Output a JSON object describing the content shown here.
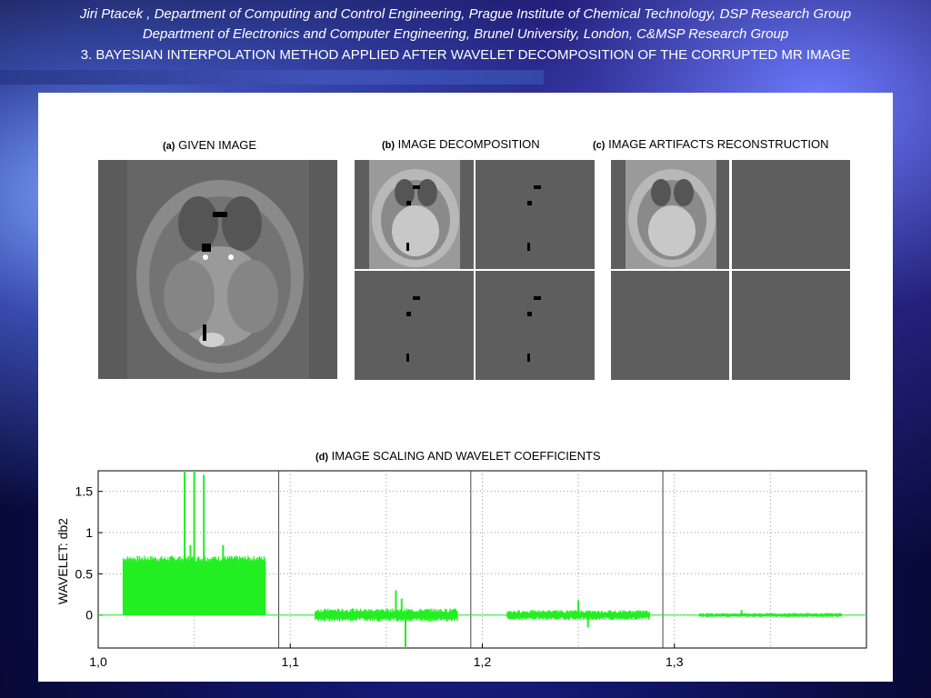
{
  "header": {
    "line1": "Jiri Ptacek ,  Department of Computing and Control Engineering, Prague Institute of Chemical Technology, DSP Research Group",
    "line2": "Department of Electronics and Computer Engineering, Brunel University, London, C&MSP Research Group",
    "line3": "3. BAYESIAN INTERPOLATION METHOD APPLIED AFTER WAVELET DECOMPOSITION OF THE CORRUPTED MR IMAGE"
  },
  "figures": {
    "a": {
      "tag": "(a)",
      "title": "GIVEN IMAGE"
    },
    "b": {
      "tag": "(b)",
      "title": "IMAGE DECOMPOSITION"
    },
    "c": {
      "tag": "(c)",
      "title": "IMAGE ARTIFACTS RECONSTRUCTION"
    },
    "d": {
      "tag": "(d)",
      "title": "IMAGE SCALING AND WAVELET COEFFICIENTS"
    }
  },
  "chart_data": {
    "type": "line",
    "title": "(d) IMAGE SCALING AND WAVELET COEFFICIENTS",
    "ylabel": "WAVELET: db2",
    "xlabel": "",
    "ylim": [
      -0.4,
      1.75
    ],
    "xlim": [
      0,
      4
    ],
    "ytick_labels": [
      "1.5",
      "1",
      "0.5",
      "0"
    ],
    "yticks": [
      1.5,
      1,
      0.5,
      0
    ],
    "xtick_labels": [
      "1,0",
      "1,1",
      "1,2",
      "1,3"
    ],
    "xticks": [
      0,
      1,
      2,
      3
    ],
    "dividers": [
      0.94,
      1.94,
      2.94
    ],
    "grid": true,
    "series_color": "#22ee22",
    "segments": [
      {
        "x_range": [
          0.13,
          0.87
        ],
        "base": 0.6,
        "amp": 0.12,
        "spikes": [
          [
            0.45,
            1.75
          ],
          [
            0.5,
            1.75
          ],
          [
            0.55,
            1.7
          ],
          [
            0.48,
            0.85
          ],
          [
            0.65,
            0.85
          ]
        ]
      },
      {
        "x_range": [
          1.13,
          1.87
        ],
        "base": 0.0,
        "amp": 0.08,
        "spikes": [
          [
            1.55,
            0.3
          ],
          [
            1.6,
            -0.4
          ],
          [
            1.58,
            0.2
          ]
        ]
      },
      {
        "x_range": [
          2.13,
          2.87
        ],
        "base": 0.0,
        "amp": 0.06,
        "spikes": [
          [
            2.5,
            0.18
          ],
          [
            2.55,
            -0.15
          ]
        ]
      },
      {
        "x_range": [
          3.13,
          3.87
        ],
        "base": 0.0,
        "amp": 0.025,
        "spikes": [
          [
            3.35,
            0.06
          ]
        ]
      }
    ]
  }
}
